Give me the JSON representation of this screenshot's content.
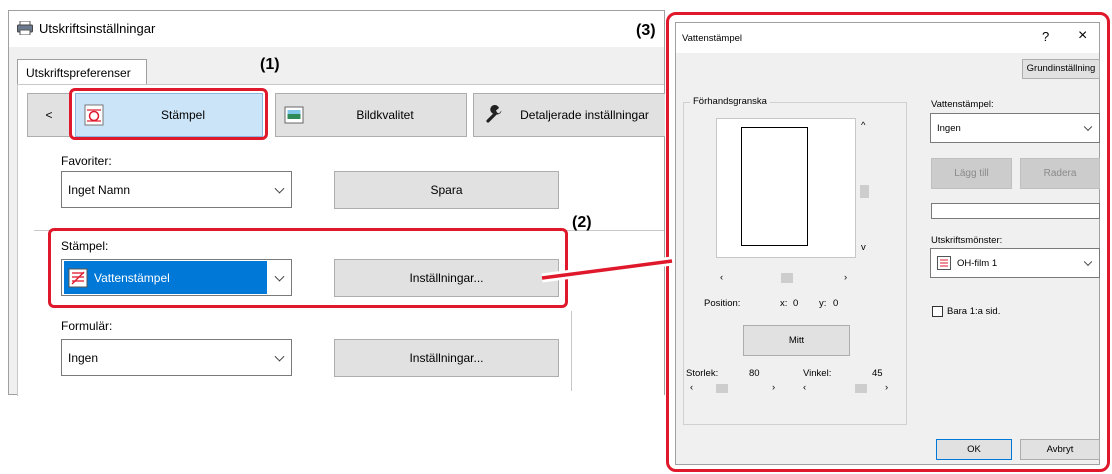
{
  "left_window": {
    "title": "Utskriftsinställningar",
    "tab": "Utskriftspreferenser",
    "toolbar": {
      "back_label": "<",
      "stamp_label": "Stämpel",
      "image_quality_label": "Bildkvalitet",
      "detailed_label": "Detaljerade inställningar"
    },
    "favorites": {
      "label": "Favoriter:",
      "value": "Inget Namn",
      "save_label": "Spara"
    },
    "stamp": {
      "label": "Stämpel:",
      "value": "Vattenstämpel",
      "settings_label": "Inställningar..."
    },
    "form": {
      "label": "Formulär:",
      "value": "Ingen",
      "settings_label": "Inställningar..."
    }
  },
  "callouts": {
    "c1": "(1)",
    "c2": "(2)",
    "c3": "(3)"
  },
  "dialog": {
    "title": "Vattenstämpel",
    "help": "?",
    "close": "×",
    "default_button": "Grundinställning",
    "preview": {
      "label": "Förhandsgranska",
      "position_label": "Position:",
      "x_label": "x:",
      "x_value": "0",
      "y_label": "y:",
      "y_value": "0",
      "center_button": "Mitt",
      "size_label": "Storlek:",
      "size_value": "80",
      "angle_label": "Vinkel:",
      "angle_value": "45"
    },
    "watermark": {
      "label": "Vattenstämpel:",
      "value": "Ingen",
      "add_button": "Lägg till",
      "delete_button": "Radera",
      "text_value": ""
    },
    "print_pattern": {
      "label": "Utskriftsmönster:",
      "value": "OH-film 1"
    },
    "first_page_only": {
      "label": "Bara 1:a sid.",
      "checked": false
    },
    "ok_button": "OK",
    "cancel_button": "Avbryt"
  },
  "colors": {
    "accent_red": "#e0182c",
    "selected_blue": "#0078d7",
    "stamp_highlight": "#cce4f7"
  }
}
